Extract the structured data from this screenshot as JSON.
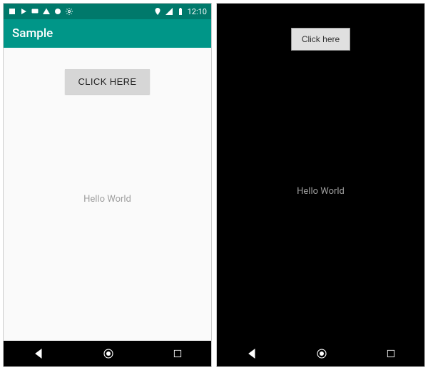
{
  "left": {
    "status": {
      "time": "12:10"
    },
    "appbar": {
      "title": "Sample"
    },
    "button": {
      "label": "CLICK HERE"
    },
    "text": {
      "hello": "Hello World"
    }
  },
  "right": {
    "status": {
      "time": ""
    },
    "button": {
      "label": "Click here"
    },
    "text": {
      "hello": "Hello World"
    }
  }
}
